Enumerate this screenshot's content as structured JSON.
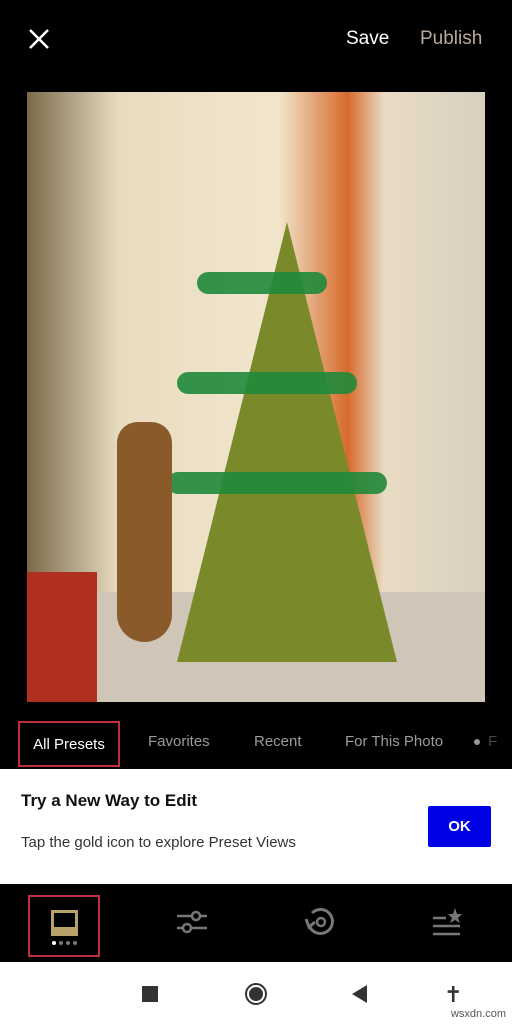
{
  "header": {
    "close_icon": "close-icon",
    "save": "Save",
    "publish": "Publish"
  },
  "photo": {
    "description_icon": "christmas-tree-photo"
  },
  "tabs": [
    "All Presets",
    "Favorites",
    "Recent",
    "For This Photo",
    "F"
  ],
  "tip": {
    "title": "Try a New Way to Edit",
    "text": "Tap the gold icon to explore Preset Views",
    "ok": "OK"
  },
  "toolbar": {
    "items": [
      "presets-icon",
      "adjust-sliders-icon",
      "history-icon",
      "favorites-list-icon"
    ],
    "accent": "#b9a26a"
  },
  "nav": [
    "recent-apps",
    "home",
    "back",
    "accessibility"
  ],
  "watermark": "wsxdn.com"
}
